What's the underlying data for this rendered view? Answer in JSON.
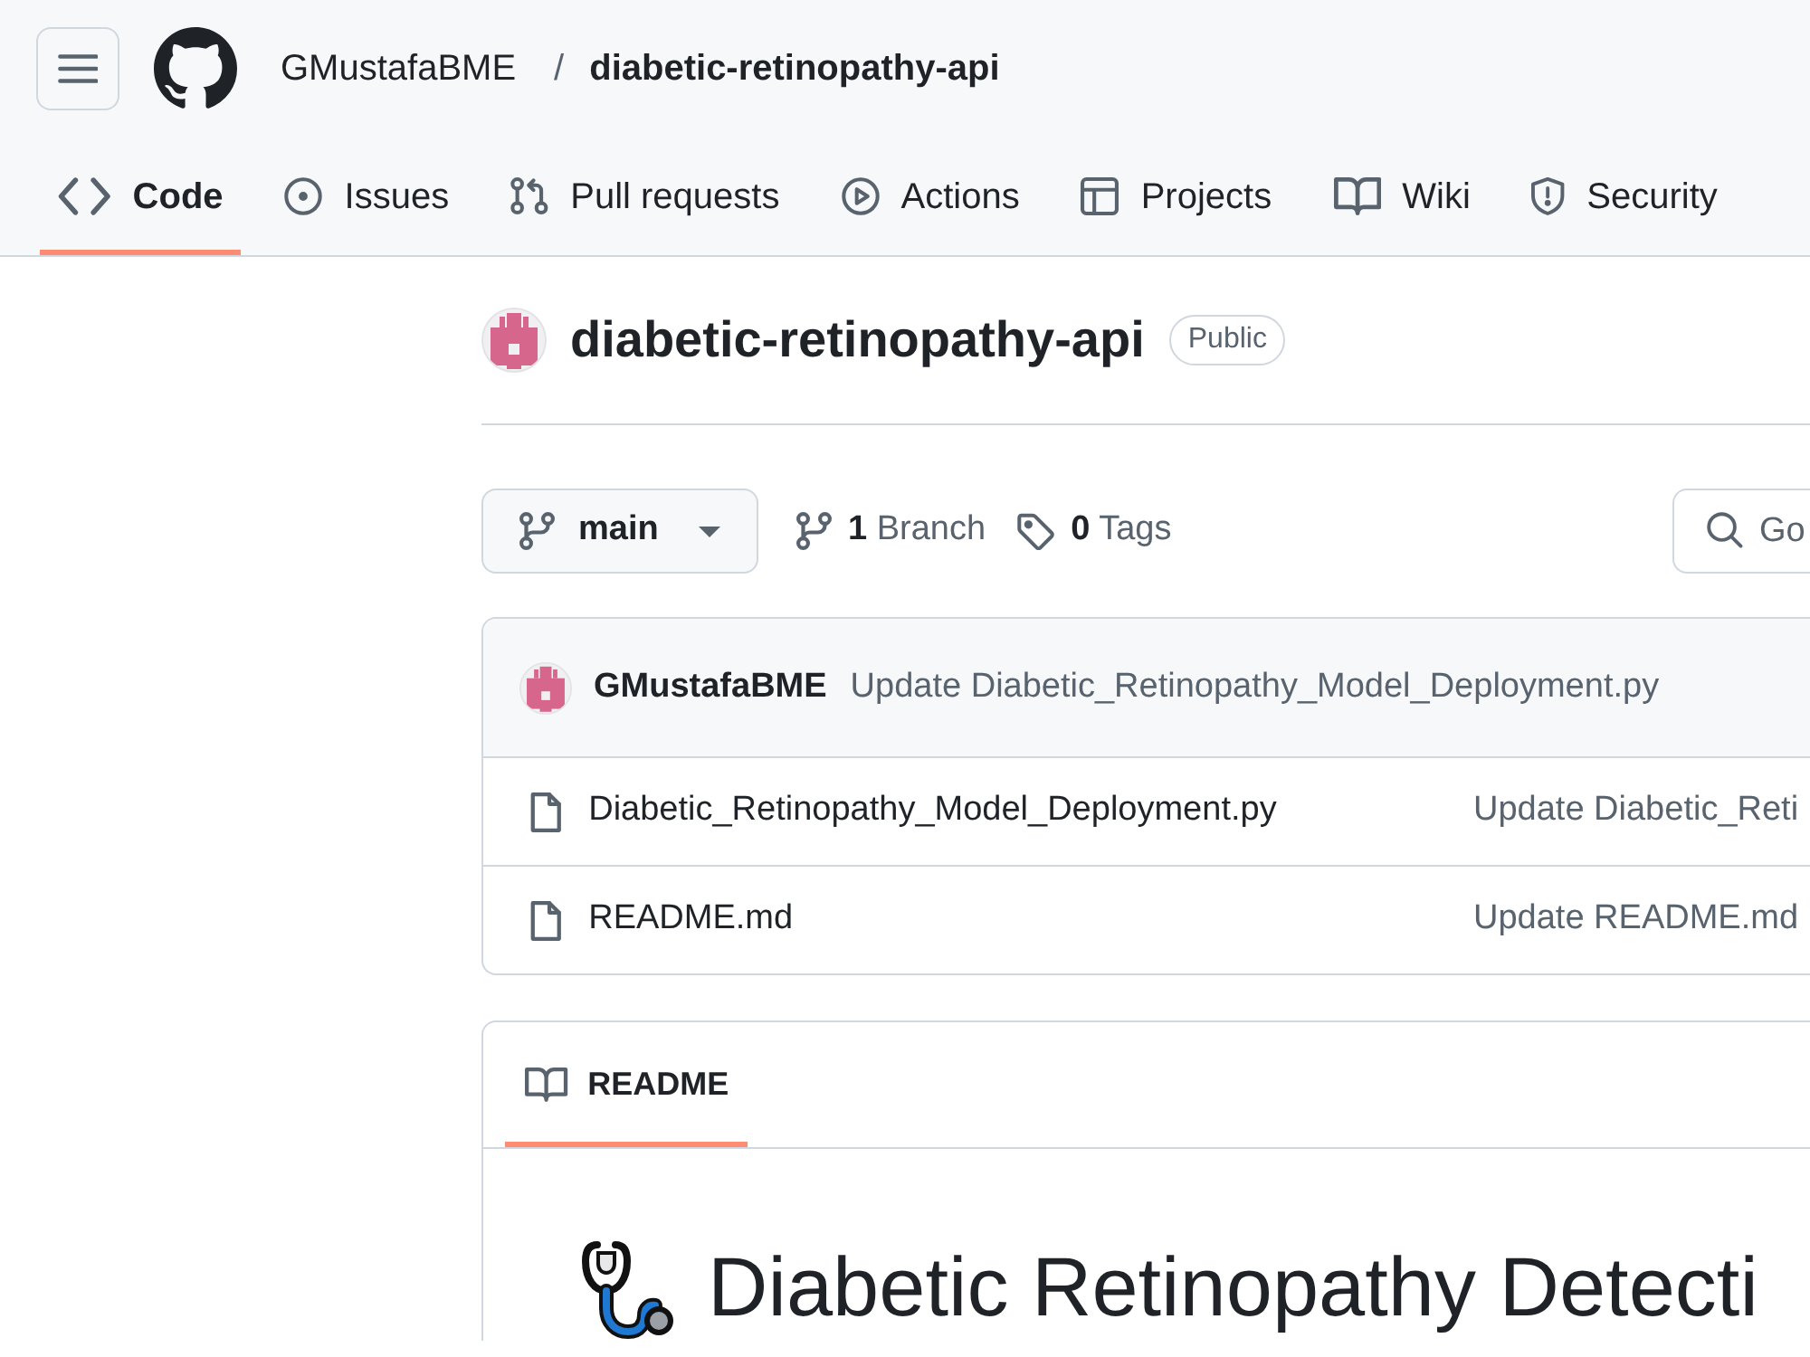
{
  "header": {
    "owner": "GMustafaBME",
    "separator": "/",
    "repo": "diabetic-retinopathy-api"
  },
  "tabs": [
    {
      "label": "Code",
      "selected": true
    },
    {
      "label": "Issues",
      "selected": false
    },
    {
      "label": "Pull requests",
      "selected": false
    },
    {
      "label": "Actions",
      "selected": false
    },
    {
      "label": "Projects",
      "selected": false
    },
    {
      "label": "Wiki",
      "selected": false
    },
    {
      "label": "Security",
      "selected": false
    }
  ],
  "repo": {
    "title": "diabetic-retinopathy-api",
    "visibility": "Public"
  },
  "toolbar": {
    "branch": "main",
    "branches": "**1** Branch",
    "tags": "**0** Tags",
    "search": {
      "placeholder": "Go"
    }
  },
  "latest_commit": {
    "author": "GMustafaBME",
    "message": "Update Diabetic_Retinopathy_Model_Deployment.py"
  },
  "files": [
    {
      "name": "Diabetic_Retinopathy_Model_Deployment.py",
      "message": "Update Diabetic_Reti"
    },
    {
      "name": "README.md",
      "message": "Update README.md"
    }
  ],
  "readme": {
    "tabs": [
      {
        "label": "README",
        "selected": true
      }
    ],
    "heading": "Diabetic Retinopathy Detecti"
  }
}
